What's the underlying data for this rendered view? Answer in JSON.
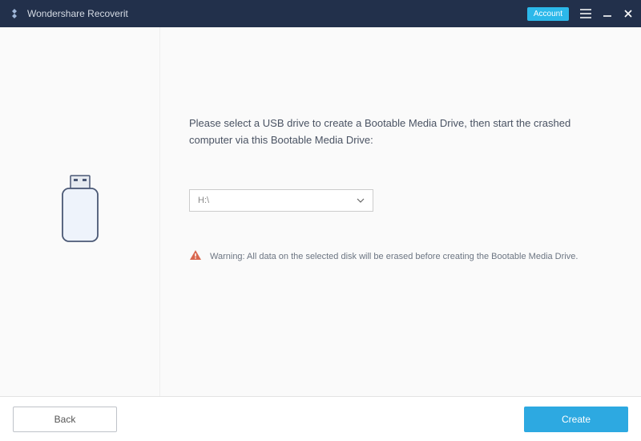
{
  "titlebar": {
    "product_name": "Wondershare Recoverit",
    "account_label": "Account"
  },
  "body": {
    "instruction": "Please select a USB drive to create a Bootable Media Drive, then start the crashed computer via this Bootable Media Drive:",
    "drive_selected": "H:\\",
    "warning_text": "Warning: All data on the selected disk will be erased before creating the Bootable Media Drive."
  },
  "footer": {
    "back_label": "Back",
    "create_label": "Create"
  }
}
